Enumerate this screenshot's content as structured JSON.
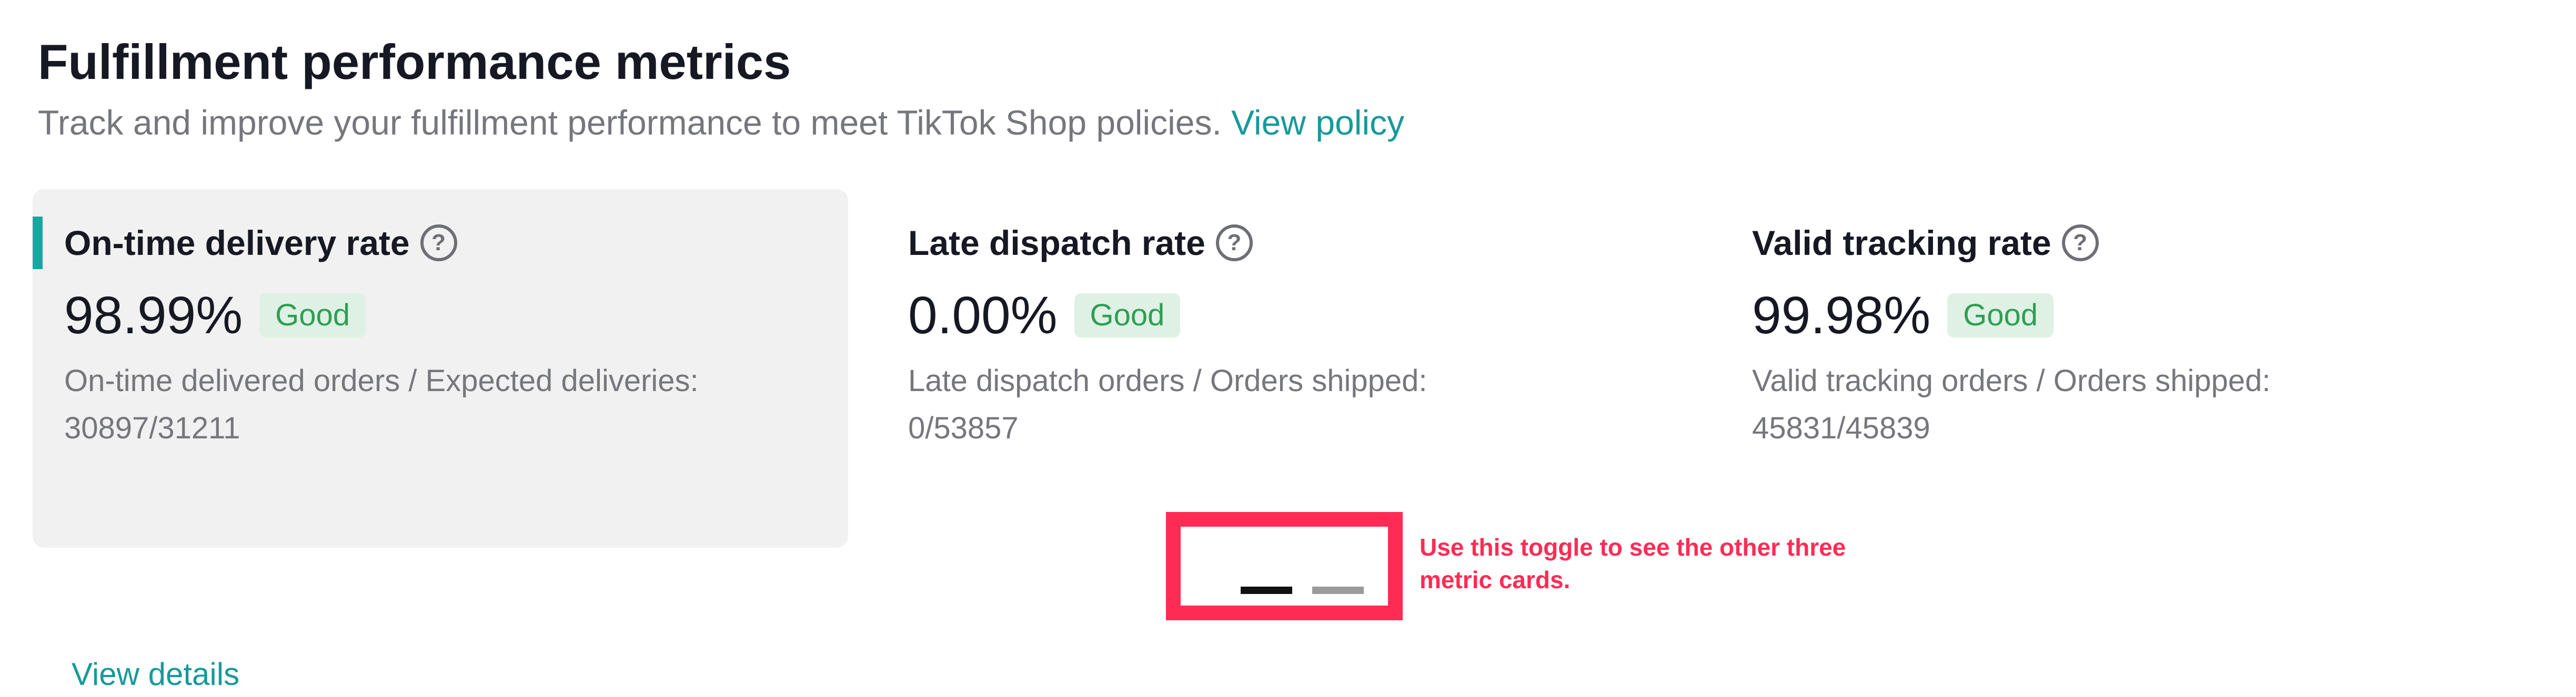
{
  "header": {
    "title": "Fulfillment performance metrics",
    "subtitle": "Track and improve your fulfillment performance to meet TikTok Shop policies. ",
    "policy_link": "View policy"
  },
  "cards": [
    {
      "name": "On-time delivery rate",
      "value": "98.99%",
      "status": "Good",
      "formula_label": "On-time delivered orders / Expected deliveries:",
      "formula_value": "30897/31211",
      "details_link": "View details",
      "active": true
    },
    {
      "name": "Late dispatch rate",
      "value": "0.00%",
      "status": "Good",
      "formula_label": "Late dispatch orders / Orders shipped:",
      "formula_value": "0/53857"
    },
    {
      "name": "Valid tracking rate",
      "value": "99.98%",
      "status": "Good",
      "formula_label": "Valid tracking orders / Orders shipped:",
      "formula_value": "45831/45839"
    }
  ],
  "help_icon_glyph": "?",
  "annotation": {
    "text": "Use this toggle to see the other three metric cards."
  },
  "colors": {
    "accent": "#18999a",
    "good_bg": "#dff1e4",
    "good_text": "#2f9e53",
    "annotation": "#fe2c55"
  }
}
